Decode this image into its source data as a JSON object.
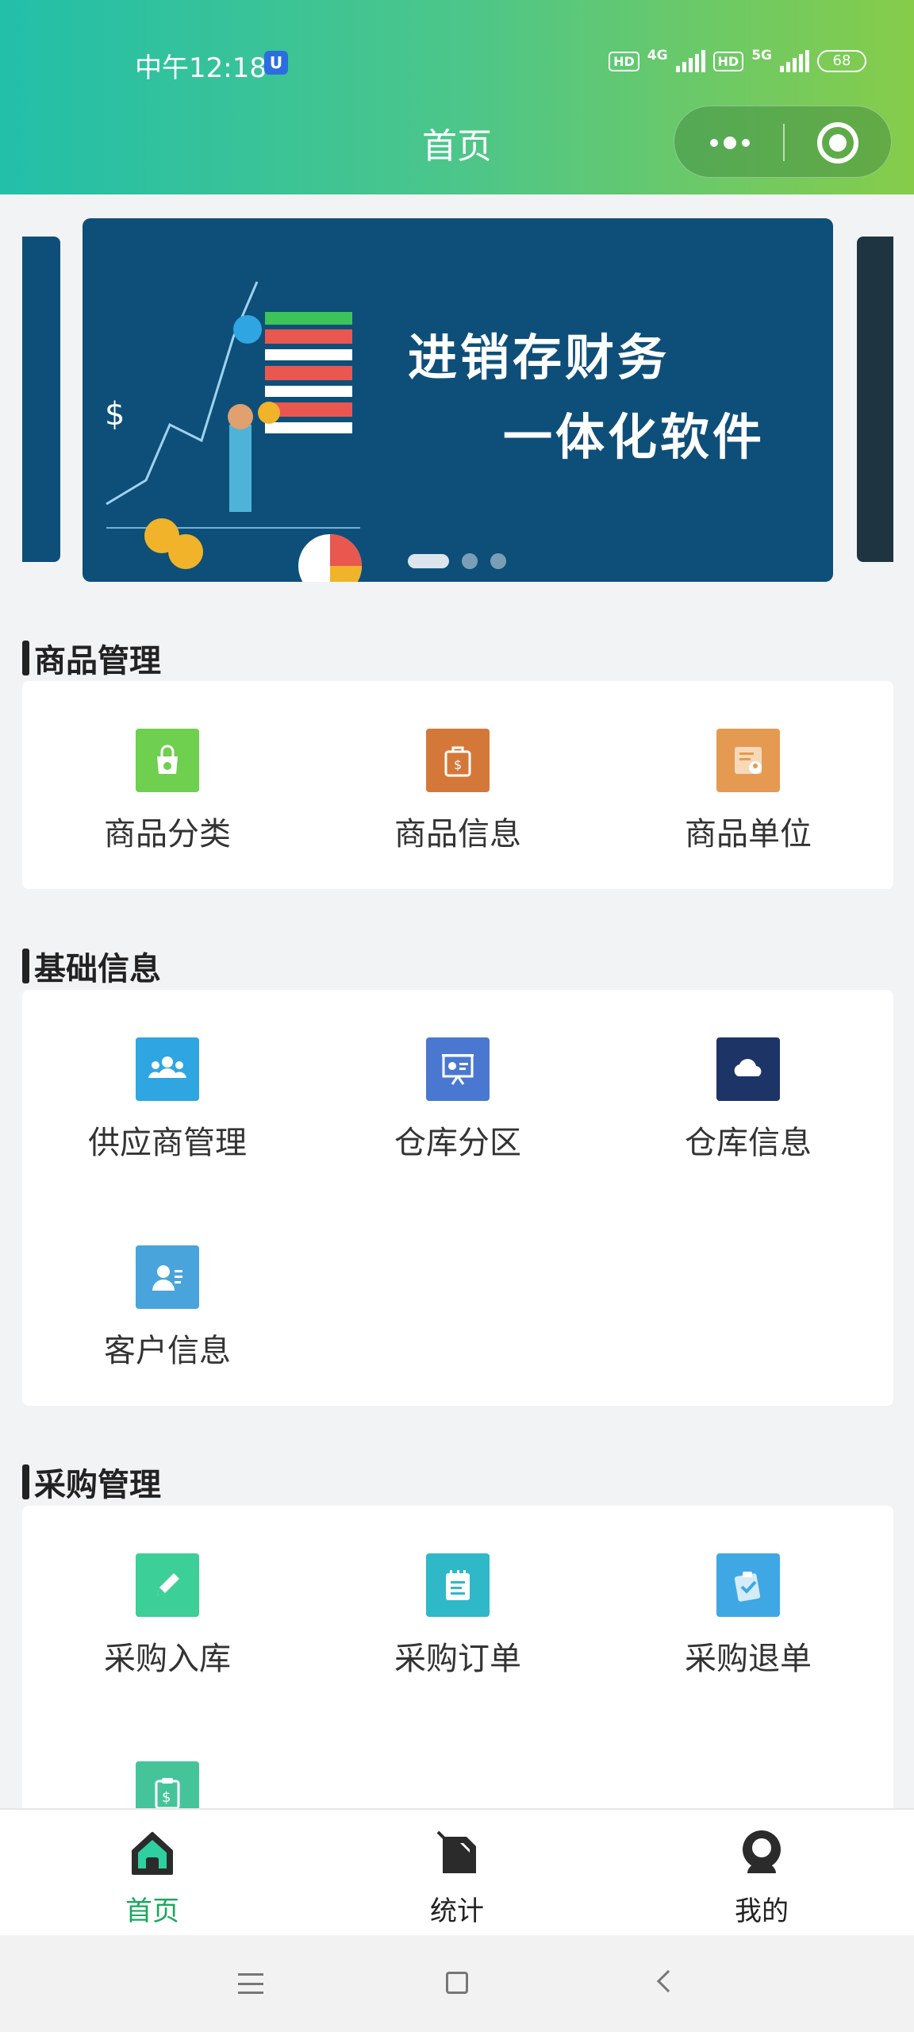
{
  "status_bar": {
    "time": "中午12:18",
    "app_badge": "U",
    "net1": "4G",
    "net2": "5G",
    "hd": "HD",
    "battery": "68"
  },
  "header": {
    "title": "首页"
  },
  "banner": {
    "line1": "进销存财务",
    "line2": "一体化软件",
    "page_count": 3,
    "active_page": 1
  },
  "sections": [
    {
      "title": "商品管理",
      "items": [
        {
          "label": "商品分类",
          "icon": "bag-icon",
          "color": "#6fcf4e"
        },
        {
          "label": "商品信息",
          "icon": "dollar-bag-icon",
          "color": "#d4783a"
        },
        {
          "label": "商品单位",
          "icon": "certificate-icon",
          "color": "#e59a52"
        }
      ]
    },
    {
      "title": "基础信息",
      "items": [
        {
          "label": "供应商管理",
          "icon": "team-icon",
          "color": "#2fa6e2"
        },
        {
          "label": "仓库分区",
          "icon": "presentation-icon",
          "color": "#4a78d0"
        },
        {
          "label": "仓库信息",
          "icon": "cloud-icon",
          "color": "#1c3466"
        },
        {
          "label": "客户信息",
          "icon": "contact-card-icon",
          "color": "#49a4dc"
        }
      ]
    },
    {
      "title": "采购管理",
      "items": [
        {
          "label": "采购入库",
          "icon": "pencil-icon",
          "color": "#3ccf98"
        },
        {
          "label": "采购订单",
          "icon": "notepad-icon",
          "color": "#2fb8c8"
        },
        {
          "label": "采购退单",
          "icon": "clipboard-check-icon",
          "color": "#3fa8e4"
        },
        {
          "label": "",
          "icon": "clipboard-dollar-icon",
          "color": "#45c49a"
        }
      ]
    }
  ],
  "tabbar": [
    {
      "label": "首页",
      "icon": "home-icon",
      "active": true
    },
    {
      "label": "统计",
      "icon": "stats-icon",
      "active": false
    },
    {
      "label": "我的",
      "icon": "profile-icon",
      "active": false
    }
  ],
  "colors": {
    "header_start": "#22bfa9",
    "header_end": "#86cc4a",
    "tab_active": "#1aa85e",
    "banner_bg": "#0e4f79"
  }
}
